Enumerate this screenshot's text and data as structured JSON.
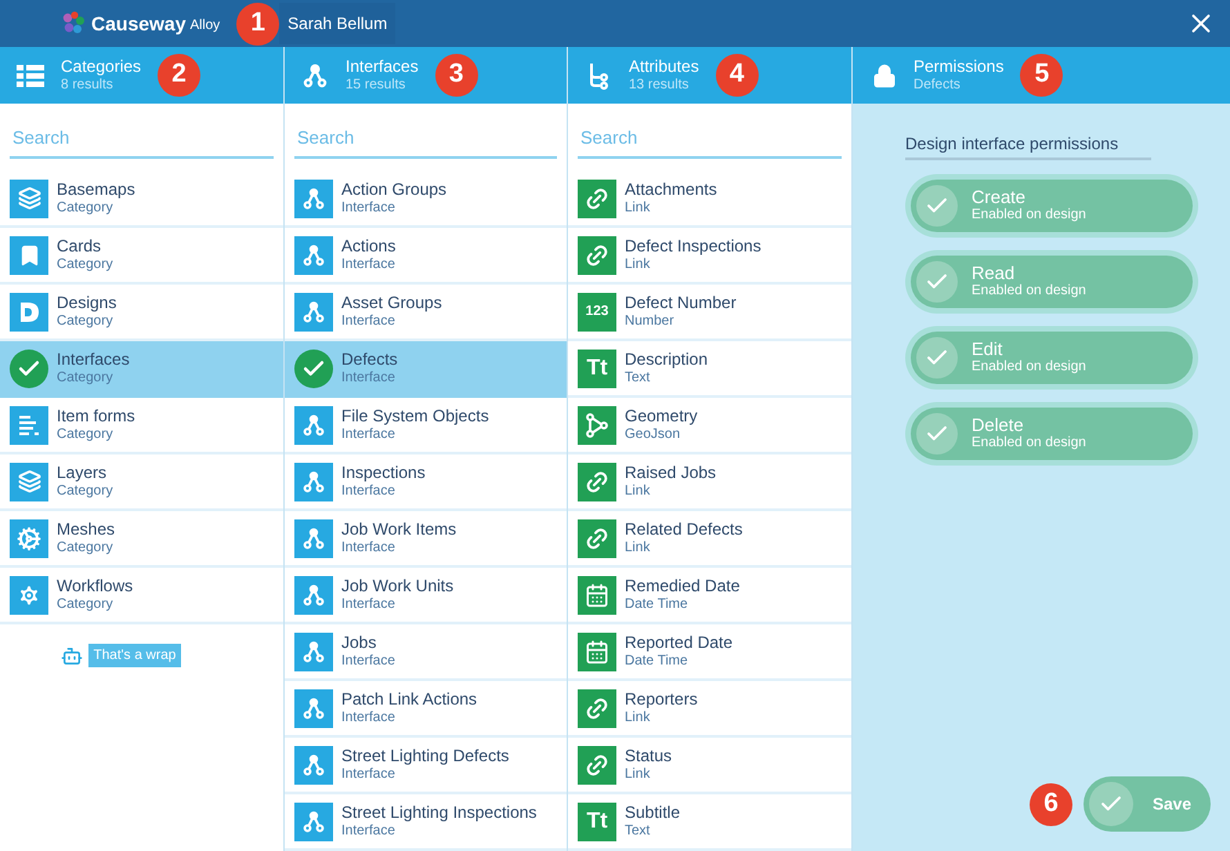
{
  "top_bar": {
    "logo": "Causeway",
    "logo_suffix": "Alloy",
    "user": "Sarah Bellum",
    "callout": "1"
  },
  "columns": [
    {
      "kind": "list",
      "title": "Categories",
      "subtitle": "8 results",
      "callout": "2",
      "search": {
        "placeholder": "Search"
      },
      "footer": "That's a wrap",
      "items": [
        {
          "kind": "stack",
          "title": "Basemaps",
          "subtitle": "Category",
          "selected": false
        },
        {
          "kind": "bookmark",
          "title": "Cards",
          "subtitle": "Category",
          "selected": false
        },
        {
          "kind": "design",
          "title": "Designs",
          "subtitle": "Category",
          "selected": false
        },
        {
          "title": "Interfaces",
          "subtitle": "Category",
          "selected": true
        },
        {
          "kind": "form",
          "title": "Item forms",
          "subtitle": "Category",
          "selected": false
        },
        {
          "kind": "stack",
          "title": "Layers",
          "subtitle": "Category",
          "selected": false
        },
        {
          "kind": "gears",
          "title": "Meshes",
          "subtitle": "Category",
          "selected": false
        },
        {
          "kind": "gear",
          "title": "Workflows",
          "subtitle": "Category",
          "selected": false
        }
      ]
    },
    {
      "kind": "interface",
      "title": "Interfaces",
      "subtitle": "15 results",
      "callout": "3",
      "search": {
        "placeholder": "Search"
      },
      "items": [
        {
          "kind": "interface",
          "title": "Action Groups",
          "subtitle": "Interface",
          "selected": false
        },
        {
          "kind": "interface",
          "title": "Actions",
          "subtitle": "Interface",
          "selected": false
        },
        {
          "kind": "interface",
          "title": "Asset Groups",
          "subtitle": "Interface",
          "selected": false
        },
        {
          "title": "Defects",
          "subtitle": "Interface",
          "selected": true
        },
        {
          "kind": "interface",
          "title": "File System Objects",
          "subtitle": "Interface",
          "selected": false
        },
        {
          "kind": "interface",
          "title": "Inspections",
          "subtitle": "Interface",
          "selected": false
        },
        {
          "kind": "interface",
          "title": "Job Work Items",
          "subtitle": "Interface",
          "selected": false
        },
        {
          "kind": "interface",
          "title": "Job Work Units",
          "subtitle": "Interface",
          "selected": false
        },
        {
          "kind": "interface",
          "title": "Jobs",
          "subtitle": "Interface",
          "selected": false
        },
        {
          "kind": "interface",
          "title": "Patch Link Actions",
          "subtitle": "Interface",
          "selected": false
        },
        {
          "kind": "interface",
          "title": "Street Lighting Defects",
          "subtitle": "Interface",
          "selected": false
        },
        {
          "kind": "interface",
          "title": "Street Lighting Inspections",
          "subtitle": "Interface",
          "selected": false
        }
      ]
    },
    {
      "kind": "attributes",
      "title": "Attributes",
      "subtitle": "13 results",
      "callout": "4",
      "search": {
        "placeholder": "Search"
      },
      "items": [
        {
          "kind": "link",
          "title": "Attachments",
          "subtitle": "Link",
          "selected": false
        },
        {
          "kind": "link",
          "title": "Defect Inspections",
          "subtitle": "Link",
          "selected": false
        },
        {
          "kind": "glyph",
          "glyph": "123",
          "title": "Defect Number",
          "subtitle": "Number",
          "selected": false
        },
        {
          "kind": "glyph",
          "glyph": "Tt",
          "title": "Description",
          "subtitle": "Text",
          "selected": false
        },
        {
          "kind": "geometry",
          "title": "Geometry",
          "subtitle": "GeoJson",
          "selected": false
        },
        {
          "kind": "link",
          "title": "Raised Jobs",
          "subtitle": "Link",
          "selected": false
        },
        {
          "kind": "link",
          "title": "Related Defects",
          "subtitle": "Link",
          "selected": false
        },
        {
          "kind": "date",
          "title": "Remedied Date",
          "subtitle": "Date Time",
          "selected": false
        },
        {
          "kind": "date",
          "title": "Reported Date",
          "subtitle": "Date Time",
          "selected": false
        },
        {
          "kind": "link",
          "title": "Reporters",
          "subtitle": "Link",
          "selected": false
        },
        {
          "kind": "link",
          "title": "Status",
          "subtitle": "Link",
          "selected": false
        },
        {
          "kind": "glyph",
          "glyph": "Tt",
          "title": "Subtitle",
          "subtitle": "Text",
          "selected": false
        }
      ]
    }
  ],
  "permissions": {
    "title": "Permissions",
    "subtitle": "Defects",
    "callout": "5",
    "heading": "Design interface permissions",
    "items": [
      {
        "label": "Create",
        "status": "Enabled on design",
        "checked": true
      },
      {
        "label": "Read",
        "status": "Enabled on design",
        "checked": true
      },
      {
        "label": "Edit",
        "status": "Enabled on design",
        "checked": true
      },
      {
        "label": "Delete",
        "status": "Enabled on design",
        "checked": true
      }
    ],
    "save": {
      "label": "Save",
      "callout": "6"
    }
  }
}
